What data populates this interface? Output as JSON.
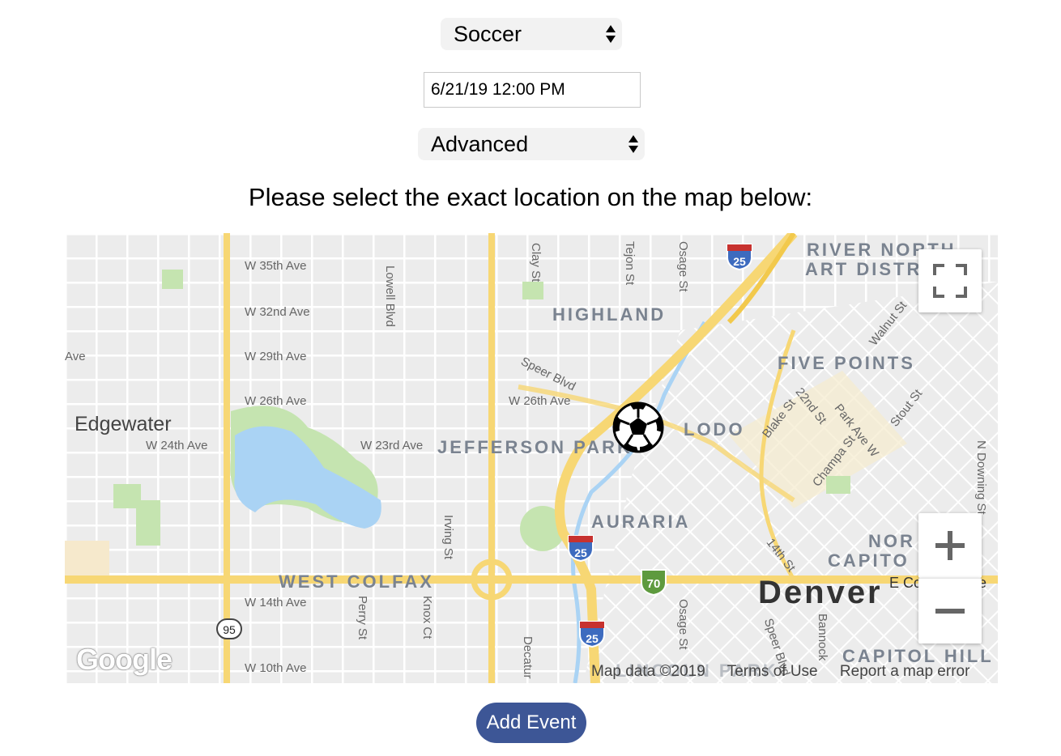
{
  "form": {
    "sport_value": "Soccer",
    "datetime_value": "6/21/19 12:00 PM",
    "level_value": "Advanced",
    "instruction": "Please select the exact location on the map below:",
    "submit_label": "Add Event"
  },
  "map": {
    "streets": [
      "W 35th Ave",
      "W 32nd Ave",
      "W 29th Ave",
      "W 26th Ave",
      "W 24th Ave",
      "W 23rd Ave",
      "W 26th Ave",
      "W 14th Ave",
      "W 10th Ave",
      "Lowell Blvd",
      "Clay St",
      "Tejon St",
      "Osage St",
      "Speer Blvd",
      "Irving St",
      "Perry St",
      "Knox Ct",
      "Decatur",
      "Osage St",
      "Speer Blvd",
      "Bannock",
      "Blake St",
      "22nd St",
      "Park Ave W",
      "Stout St",
      "Walnut St",
      "Champa St",
      "14th St",
      "N Downing St",
      "Ave",
      "E Co",
      "e"
    ],
    "neighborhoods": [
      "HIGHLAND",
      "RIVER NORTH",
      "ART DISTR",
      "FIVE POINTS",
      "LODO",
      "JEFFERSON PARK",
      "AURARIA",
      "WEST COLFAX",
      "NOR",
      "CAPITO",
      "CAPITOL HILL",
      "LINCOLN PARK"
    ],
    "place": "Edgewater",
    "city": "Denver",
    "shields": [
      "25",
      "25",
      "25",
      "70",
      "95"
    ],
    "logo_text": "Google",
    "attribution": {
      "data": "Map data ©2019",
      "terms": "Terms of Use",
      "report": "Report a map error"
    },
    "marker_icon": "soccer-ball-icon",
    "colors": {
      "highway": "#f7d774",
      "park": "#c5e4b0",
      "water": "#aad3f4",
      "button": "#3d5696"
    }
  }
}
